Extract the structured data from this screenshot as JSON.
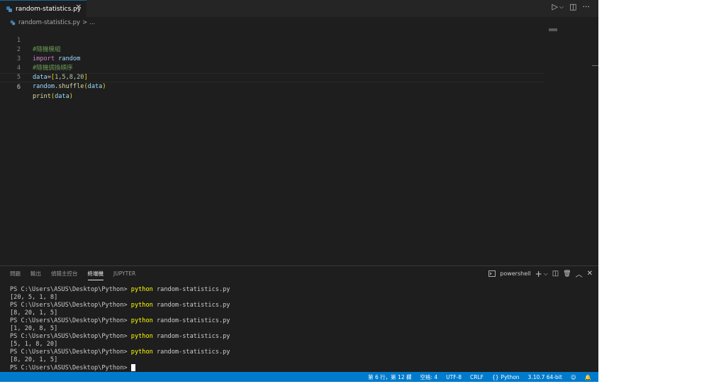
{
  "tab": {
    "label": "random-statistics.py",
    "close": "✕"
  },
  "editor_actions": {
    "run": "▷",
    "run_dropdown": "⌵",
    "split": "◫",
    "more": "···"
  },
  "breadcrumb": {
    "file": "random-statistics.py",
    "separator": ">",
    "more": "..."
  },
  "code_lines": [
    {
      "n": "1"
    },
    {
      "n": "2"
    },
    {
      "n": "3"
    },
    {
      "n": "4"
    },
    {
      "n": "5"
    },
    {
      "n": "6"
    }
  ],
  "code_text": {
    "l1_comment": "#隨機模組",
    "l2_import": "import",
    "l2_module": "random",
    "l3_comment": "#隨機調換順序",
    "l4_var": "data",
    "l4_eq": "=",
    "l4_open": "[",
    "l4_vals": "1,5,8,20",
    "l4_close": "]",
    "l5_obj": "random",
    "l5_dot": ".",
    "l5_fn": "shuffle",
    "l5_open": "(",
    "l5_arg": "data",
    "l5_close": ")",
    "l6_fn": "print",
    "l6_open": "(",
    "l6_arg": "data",
    "l6_close": ")"
  },
  "panel": {
    "tabs": [
      "問題",
      "輸出",
      "偵錯主控台",
      "終端機",
      "JUPYTER"
    ],
    "active_tab": "終端機",
    "terminal_name": "powershell",
    "actions": {
      "add": "+",
      "add_dropdown": "⌵",
      "split": "◫",
      "trash": "🗑",
      "maximize": "︿",
      "close": "✕"
    }
  },
  "terminal": {
    "prompt": "PS C:\\Users\\ASUS\\Desktop\\Python>",
    "command": "python",
    "args": "random-statistics.py",
    "outputs": [
      "[20, 5, 1, 8]",
      "[8, 20, 1, 5]",
      "[1, 20, 8, 5]",
      "[5, 1, 8, 20]",
      "[8, 20, 1, 5]"
    ]
  },
  "status": {
    "position": "第 6 行，第 12 欄",
    "spaces": "空格: 4",
    "encoding": "UTF-8",
    "eol": "CRLF",
    "language": "Python",
    "interpreter": "3.10.7 64-bit",
    "feedback_icon": "☺",
    "bell_icon": "🔔"
  },
  "colors": {
    "accent": "#007acc",
    "editor_bg": "#1e1e1e",
    "terminal_cmd": "#ffff00"
  }
}
